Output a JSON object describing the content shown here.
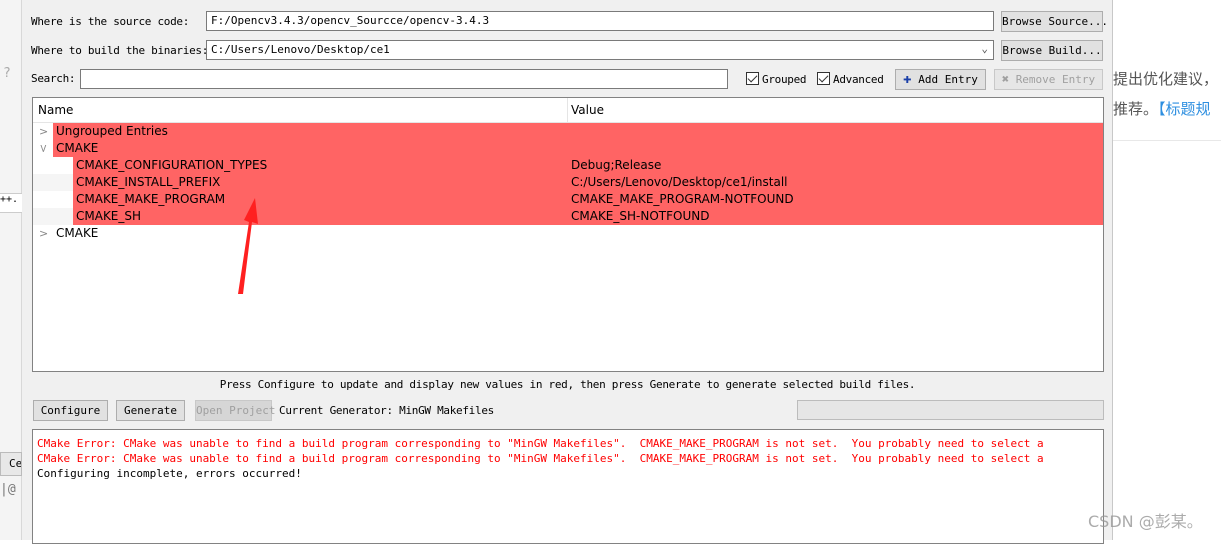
{
  "background": {
    "left_fragments": [
      "?",
      "++. (",
      "Ce",
      "|@"
    ],
    "right_text_1": "提出优化建议，",
    "right_text_2": "推荐。",
    "right_link": "【标题规",
    "watermark": "CSDN @彭某。"
  },
  "source": {
    "label": "Where is the source code:",
    "value": "F:/Opencv3.4.3/opencv_Sourcce/opencv-3.4.3",
    "browse": "Browse Source..."
  },
  "build": {
    "label": "Where to build the binaries:",
    "value": "C:/Users/Lenovo/Desktop/ce1",
    "browse": "Browse Build..."
  },
  "search": {
    "label": "Search:",
    "value": ""
  },
  "options": {
    "grouped": "Grouped",
    "grouped_checked": true,
    "advanced": "Advanced",
    "advanced_checked": true,
    "add_entry": "Add Entry",
    "remove_entry": "Remove Entry"
  },
  "tree": {
    "headers": {
      "name": "Name",
      "value": "Value"
    },
    "highlight_color": "#ff6464",
    "rows": [
      {
        "name": "Ungrouped Entries",
        "value": "",
        "expanded": false,
        "level": 0,
        "highlighted": true
      },
      {
        "name": "CMAKE",
        "value": "",
        "expanded": true,
        "level": 0,
        "highlighted": true
      },
      {
        "name": "CMAKE_CONFIGURATION_TYPES",
        "value": "Debug;Release",
        "level": 1,
        "highlighted": true
      },
      {
        "name": "CMAKE_INSTALL_PREFIX",
        "value": "C:/Users/Lenovo/Desktop/ce1/install",
        "level": 1,
        "highlighted": true
      },
      {
        "name": "CMAKE_MAKE_PROGRAM",
        "value": "CMAKE_MAKE_PROGRAM-NOTFOUND",
        "level": 1,
        "highlighted": true
      },
      {
        "name": "CMAKE_SH",
        "value": "CMAKE_SH-NOTFOUND",
        "level": 1,
        "highlighted": true
      },
      {
        "name": "CMAKE",
        "value": "",
        "expanded": false,
        "level": 0,
        "highlighted": false
      }
    ]
  },
  "status_hint": "Press Configure to update and display new values in red, then press Generate to generate selected build files.",
  "actions": {
    "configure": "Configure",
    "generate": "Generate",
    "open_project": "Open Project",
    "current_generator": "Current Generator: MinGW Makefiles",
    "progress": 0
  },
  "output": {
    "lines": [
      {
        "text": "CMake Error: CMake was unable to find a build program corresponding to \"MinGW Makefiles\".  CMAKE_MAKE_PROGRAM is not set.  You probably need to select a",
        "error": true
      },
      {
        "text": "CMake Error: CMake was unable to find a build program corresponding to \"MinGW Makefiles\".  CMAKE_MAKE_PROGRAM is not set.  You probably need to select a",
        "error": true
      },
      {
        "text": "Configuring incomplete, errors occurred!",
        "error": false
      }
    ]
  },
  "annotation_color": "#ff2020"
}
